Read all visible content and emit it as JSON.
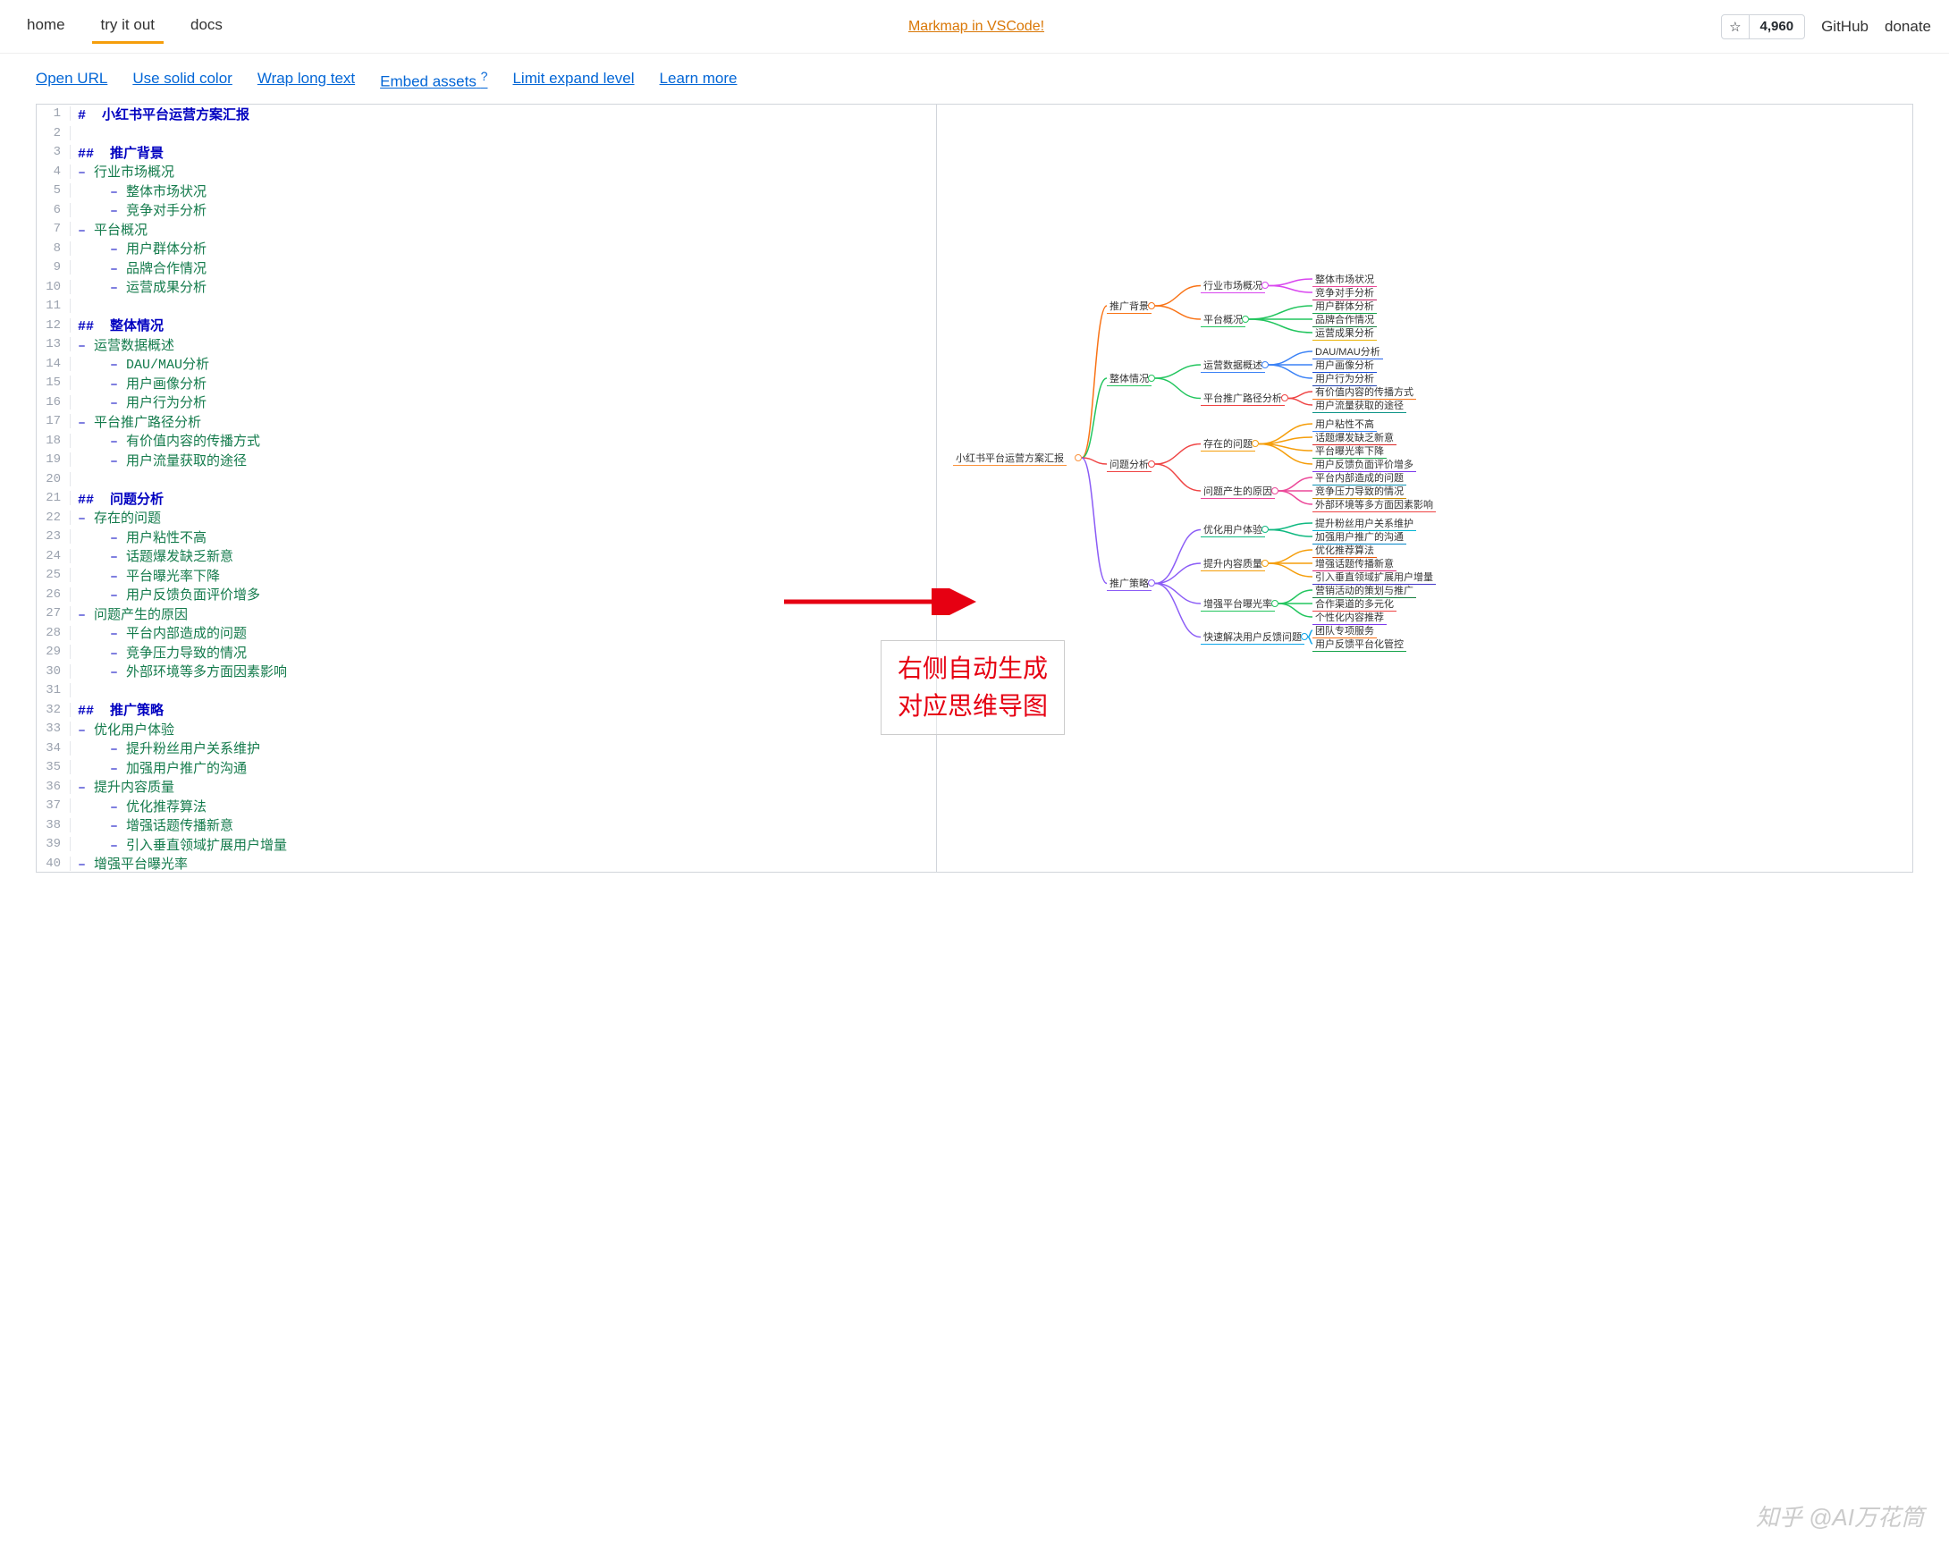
{
  "nav": {
    "home": "home",
    "try": "try it out",
    "docs": "docs",
    "promo": "Markmap in VSCode!",
    "stars": "4,960",
    "github": "GitHub",
    "donate": "donate"
  },
  "toolbar": {
    "open_url": "Open URL",
    "solid_color": "Use solid color",
    "wrap": "Wrap long text",
    "embed": "Embed assets",
    "embed_sup": "?",
    "limit": "Limit expand level",
    "learn": "Learn more"
  },
  "editor_lines": [
    {
      "n": 1,
      "type": "h1",
      "text": "#  小红书平台运营方案汇报"
    },
    {
      "n": 2,
      "type": "blank",
      "text": ""
    },
    {
      "n": 3,
      "type": "h2",
      "text": "##  推广背景"
    },
    {
      "n": 4,
      "type": "li1",
      "text": "行业市场概况"
    },
    {
      "n": 5,
      "type": "li2",
      "text": "整体市场状况"
    },
    {
      "n": 6,
      "type": "li2",
      "text": "竞争对手分析"
    },
    {
      "n": 7,
      "type": "li1",
      "text": "平台概况"
    },
    {
      "n": 8,
      "type": "li2",
      "text": "用户群体分析"
    },
    {
      "n": 9,
      "type": "li2",
      "text": "品牌合作情况"
    },
    {
      "n": 10,
      "type": "li2",
      "text": "运营成果分析"
    },
    {
      "n": 11,
      "type": "blank",
      "text": ""
    },
    {
      "n": 12,
      "type": "h2",
      "text": "##  整体情况"
    },
    {
      "n": 13,
      "type": "li1",
      "text": "运营数据概述"
    },
    {
      "n": 14,
      "type": "li2",
      "text": "DAU/MAU分析"
    },
    {
      "n": 15,
      "type": "li2",
      "text": "用户画像分析"
    },
    {
      "n": 16,
      "type": "li2",
      "text": "用户行为分析"
    },
    {
      "n": 17,
      "type": "li1",
      "text": "平台推广路径分析"
    },
    {
      "n": 18,
      "type": "li2",
      "text": "有价值内容的传播方式"
    },
    {
      "n": 19,
      "type": "li2",
      "text": "用户流量获取的途径"
    },
    {
      "n": 20,
      "type": "blank",
      "text": ""
    },
    {
      "n": 21,
      "type": "h2",
      "text": "##  问题分析"
    },
    {
      "n": 22,
      "type": "li1",
      "text": "存在的问题"
    },
    {
      "n": 23,
      "type": "li2",
      "text": "用户粘性不高"
    },
    {
      "n": 24,
      "type": "li2",
      "text": "话题爆发缺乏新意"
    },
    {
      "n": 25,
      "type": "li2",
      "text": "平台曝光率下降"
    },
    {
      "n": 26,
      "type": "li2",
      "text": "用户反馈负面评价增多"
    },
    {
      "n": 27,
      "type": "li1",
      "text": "问题产生的原因"
    },
    {
      "n": 28,
      "type": "li2",
      "text": "平台内部造成的问题"
    },
    {
      "n": 29,
      "type": "li2",
      "text": "竞争压力导致的情况"
    },
    {
      "n": 30,
      "type": "li2",
      "text": "外部环境等多方面因素影响"
    },
    {
      "n": 31,
      "type": "blank",
      "text": ""
    },
    {
      "n": 32,
      "type": "h2",
      "text": "##  推广策略"
    },
    {
      "n": 33,
      "type": "li1",
      "text": "优化用户体验"
    },
    {
      "n": 34,
      "type": "li2",
      "text": "提升粉丝用户关系维护"
    },
    {
      "n": 35,
      "type": "li2",
      "text": "加强用户推广的沟通"
    },
    {
      "n": 36,
      "type": "li1",
      "text": "提升内容质量"
    },
    {
      "n": 37,
      "type": "li2",
      "text": "优化推荐算法"
    },
    {
      "n": 38,
      "type": "li2",
      "text": "增强话题传播新意"
    },
    {
      "n": 39,
      "type": "li2",
      "text": "引入垂直领域扩展用户增量"
    },
    {
      "n": 40,
      "type": "li1",
      "text": "增强平台曝光率"
    }
  ],
  "mindmap": {
    "root": {
      "label": "小红书平台运营方案汇报",
      "color": "#fb923c"
    },
    "branches": [
      {
        "label": "推广背景",
        "color": "#f97316",
        "children": [
          {
            "label": "行业市场概况",
            "color": "#d946ef",
            "children": [
              {
                "label": "整体市场状况",
                "color": "#ec4899"
              },
              {
                "label": "竞争对手分析",
                "color": "#be185d"
              }
            ]
          },
          {
            "label": "平台概况",
            "color": "#22c55e",
            "children": [
              {
                "label": "用户群体分析",
                "color": "#16a34a"
              },
              {
                "label": "品牌合作情况",
                "color": "#15803d"
              },
              {
                "label": "运营成果分析",
                "color": "#eab308"
              }
            ]
          }
        ]
      },
      {
        "label": "整体情况",
        "color": "#22c55e",
        "children": [
          {
            "label": "运营数据概述",
            "color": "#3b82f6",
            "children": [
              {
                "label": "DAU/MAU分析",
                "color": "#2563eb"
              },
              {
                "label": "用户画像分析",
                "color": "#1d4ed8"
              },
              {
                "label": "用户行为分析",
                "color": "#1e40af"
              }
            ]
          },
          {
            "label": "平台推广路径分析",
            "color": "#ef4444",
            "children": [
              {
                "label": "有价值内容的传播方式",
                "color": "#f97316"
              },
              {
                "label": "用户流量获取的途径",
                "color": "#0d9488"
              }
            ]
          }
        ]
      },
      {
        "label": "问题分析",
        "color": "#ef4444",
        "children": [
          {
            "label": "存在的问题",
            "color": "#f59e0b",
            "children": [
              {
                "label": "用户粘性不高",
                "color": "#3b82f6"
              },
              {
                "label": "话题爆发缺乏新意",
                "color": "#dc2626"
              },
              {
                "label": "平台曝光率下降",
                "color": "#16a34a"
              },
              {
                "label": "用户反馈负面评价增多",
                "color": "#7c3aed"
              }
            ]
          },
          {
            "label": "问题产生的原因",
            "color": "#ec4899",
            "children": [
              {
                "label": "平台内部造成的问题",
                "color": "#0891b2"
              },
              {
                "label": "竞争压力导致的情况",
                "color": "#ca8a04"
              },
              {
                "label": "外部环境等多方面因素影响",
                "color": "#ef4444"
              }
            ]
          }
        ]
      },
      {
        "label": "推广策略",
        "color": "#8b5cf6",
        "children": [
          {
            "label": "优化用户体验",
            "color": "#10b981",
            "children": [
              {
                "label": "提升粉丝用户关系维护",
                "color": "#06b6d4"
              },
              {
                "label": "加强用户推广的沟通",
                "color": "#0284c7"
              }
            ]
          },
          {
            "label": "提升内容质量",
            "color": "#f59e0b",
            "children": [
              {
                "label": "优化推荐算法",
                "color": "#ea580c"
              },
              {
                "label": "增强话题传播新意",
                "color": "#db2777"
              },
              {
                "label": "引入垂直领域扩展用户增量",
                "color": "#4338ca"
              }
            ]
          },
          {
            "label": "增强平台曝光率",
            "color": "#22c55e",
            "children": [
              {
                "label": "营销活动的策划与推广",
                "color": "#15803d"
              },
              {
                "label": "合作渠道的多元化",
                "color": "#ef4444"
              },
              {
                "label": "个性化内容推荐",
                "color": "#7c3aed"
              }
            ]
          },
          {
            "label": "快速解决用户反馈问题",
            "color": "#0ea5e9",
            "children": [
              {
                "label": "团队专项服务",
                "color": "#f97316"
              },
              {
                "label": "用户反馈平台化管控",
                "color": "#16a34a"
              }
            ]
          }
        ]
      }
    ]
  },
  "annotation": {
    "line1": "右侧自动生成",
    "line2": "对应思维导图"
  },
  "watermark": "知乎 @AI万花筒"
}
